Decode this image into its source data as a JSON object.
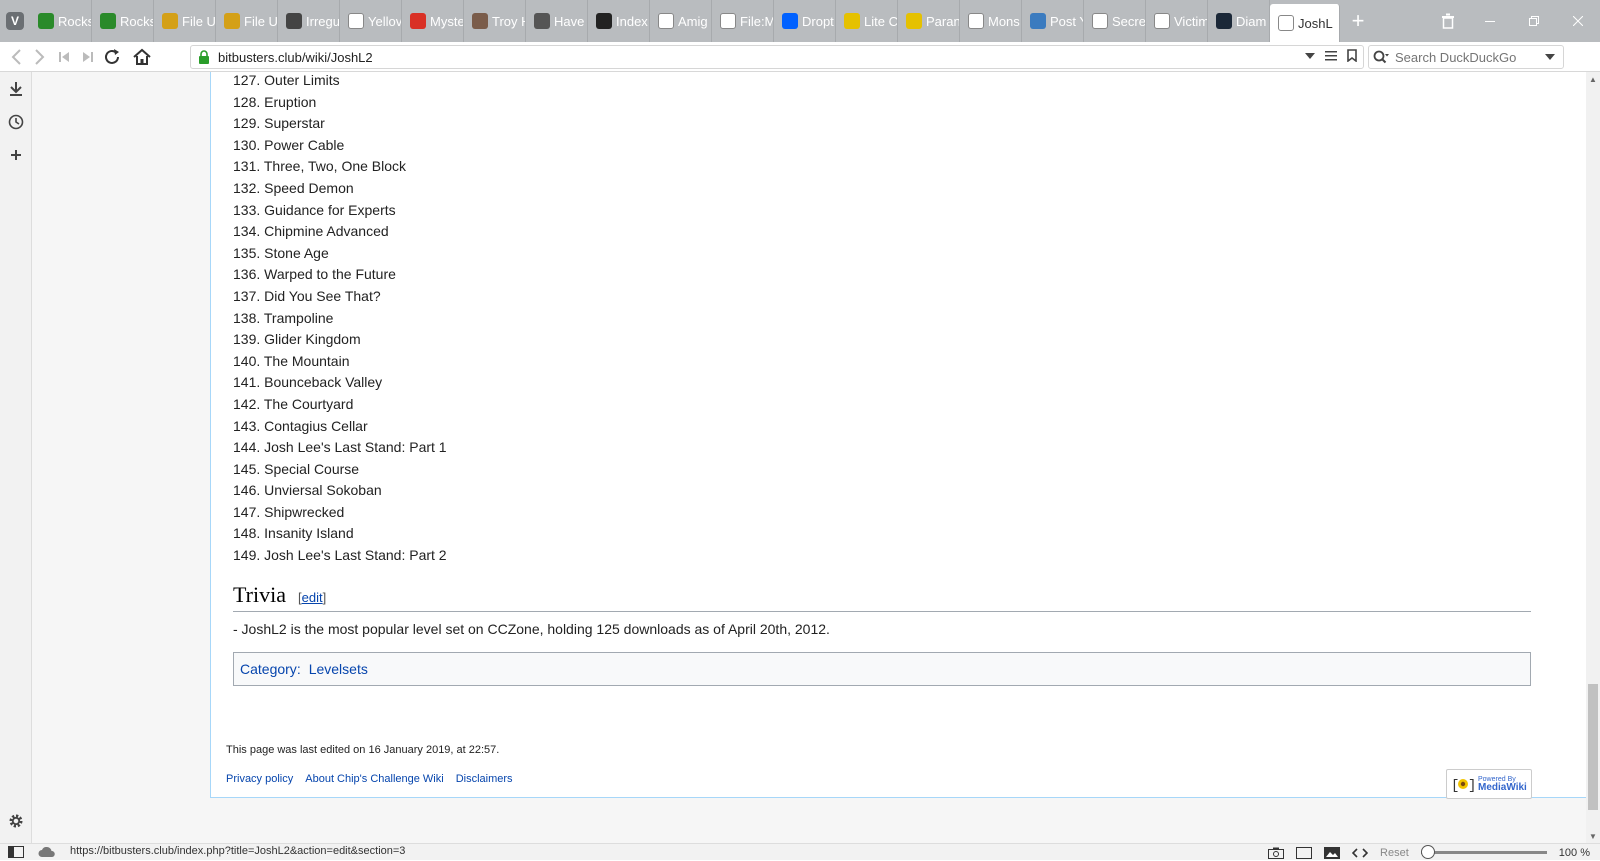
{
  "browser": {
    "tabs": [
      {
        "label": "Rocks",
        "favicon": "green-gem-icon",
        "color": "#2a8a2a"
      },
      {
        "label": "Rocks",
        "favicon": "green-gem-icon",
        "color": "#2a8a2a"
      },
      {
        "label": "File U",
        "favicon": "wikia-icon",
        "color": "#d4a017"
      },
      {
        "label": "File U",
        "favicon": "wikia-icon",
        "color": "#d4a017"
      },
      {
        "label": "Irregu",
        "favicon": "comic-icon",
        "color": "#444444"
      },
      {
        "label": "Yellov",
        "favicon": "page-icon",
        "color": "#ffffff"
      },
      {
        "label": "Myste",
        "favicon": "gmail-icon",
        "color": "#d93025"
      },
      {
        "label": "Troy H",
        "favicon": "photo-icon",
        "color": "#7a5c4a"
      },
      {
        "label": "Have",
        "favicon": "dash-icon",
        "color": "#555555"
      },
      {
        "label": "Index",
        "favicon": "dark-site-icon",
        "color": "#222222"
      },
      {
        "label": "Amig",
        "favicon": "wikipedia-icon",
        "color": "#ffffff"
      },
      {
        "label": "File:M",
        "favicon": "page-icon",
        "color": "#ffffff"
      },
      {
        "label": "Dropt",
        "favicon": "dropbox-icon",
        "color": "#0061ff"
      },
      {
        "label": "Lite C",
        "favicon": "tv-icon",
        "color": "#e5c100"
      },
      {
        "label": "Paran",
        "favicon": "tv-icon",
        "color": "#e5c100"
      },
      {
        "label": "Mons",
        "favicon": "page-icon",
        "color": "#ffffff"
      },
      {
        "label": "Post Y",
        "favicon": "x-icon",
        "color": "#3b7bbf"
      },
      {
        "label": "Secre",
        "favicon": "page-icon",
        "color": "#ffffff"
      },
      {
        "label": "Victim",
        "favicon": "page-icon",
        "color": "#ffffff"
      },
      {
        "label": "Diam",
        "favicon": "steam-icon",
        "color": "#1b2838"
      },
      {
        "label": "JoshL",
        "favicon": "page-icon",
        "color": "#ffffff",
        "active": true
      }
    ],
    "address": "bitbusters.club/wiki/JoshL2",
    "search_placeholder": "Search DuckDuckGo",
    "status_url": "https://bitbusters.club/index.php?title=JoshL2&action=edit&section=3",
    "zoom_reset_label": "Reset",
    "zoom_level": "100 %"
  },
  "article": {
    "levels": [
      "127. Outer Limits",
      "128. Eruption",
      "129. Superstar",
      "130. Power Cable",
      "131. Three, Two, One Block",
      "132. Speed Demon",
      "133. Guidance for Experts",
      "134. Chipmine Advanced",
      "135. Stone Age",
      "136. Warped to the Future",
      "137. Did You See That?",
      "138. Trampoline",
      "139. Glider Kingdom",
      "140. The Mountain",
      "141. Bounceback Valley",
      "142. The Courtyard",
      "143. Contagius Cellar",
      "144. Josh Lee's Last Stand: Part 1",
      "145. Special Course",
      "146. Unviersal Sokoban",
      "147. Shipwrecked",
      "148. Insanity Island",
      "149. Josh Lee's Last Stand: Part 2"
    ],
    "trivia_heading": "Trivia",
    "edit_link": "edit",
    "trivia_text": "- JoshL2 is the most popular level set on CCZone, holding 125 downloads as of April 20th, 2012.",
    "category_label": "Category",
    "category_value": "Levelsets"
  },
  "footer": {
    "last_edited": "This page was last edited on 16 January 2019, at 22:57.",
    "links": [
      "Privacy policy",
      "About Chip's Challenge Wiki",
      "Disclaimers"
    ],
    "powered_by_small": "Powered By",
    "powered_by_big": "MediaWiki"
  }
}
